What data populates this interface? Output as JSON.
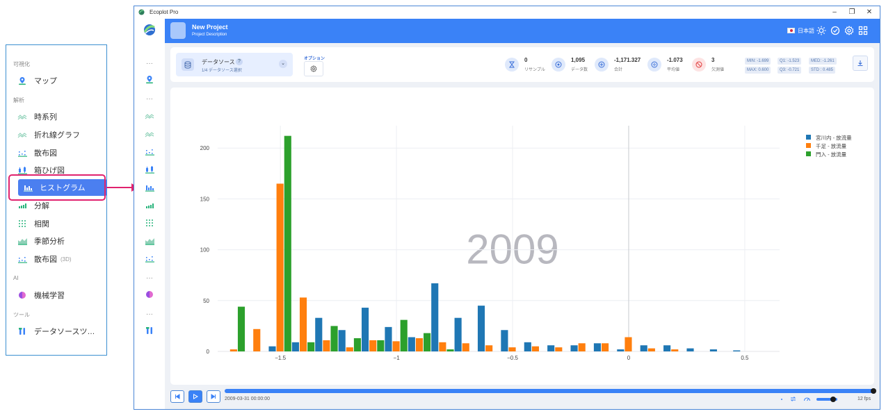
{
  "window": {
    "app_title": "Ecoplot Pro"
  },
  "menu": {
    "sections": {
      "visualization": "可視化",
      "analysis": "解析",
      "ai": "AI",
      "tools": "ツール"
    },
    "items": {
      "map": "マップ",
      "timeseries": "時系列",
      "line": "折れ線グラフ",
      "scatter": "散布図",
      "boxplot": "箱ひげ図",
      "histogram": "ヒストグラム",
      "decomposition": "分解",
      "correlation": "相関",
      "seasonal": "季節分析",
      "scatter3d": "散布図",
      "scatter3d_tag": "(3D)",
      "ml": "機械学習",
      "datasource_tools": "データソースツ…"
    },
    "active_item": "histogram"
  },
  "header": {
    "project_name": "New Project",
    "project_description": "Project Description",
    "language": "日本語"
  },
  "toolbar": {
    "datasource_title": "データソース",
    "datasource_help": "?",
    "datasource_subtitle": "1/4 データソース選択",
    "options_label": "オプション",
    "stats": {
      "resample_value": "0",
      "resample_label": "リサンプル",
      "count_value": "1,095",
      "count_label": "データ数",
      "sum_value": "-1,171.327",
      "sum_label": "合計",
      "mean_value": "-1.073",
      "mean_label": "平均値",
      "missing_value": "3",
      "missing_label": "欠測値"
    },
    "quantiles": {
      "min": "MIN: -1.699",
      "q1": "Q1:   -1.523",
      "med": "MED: -1.261",
      "max": "MAX: 0.600",
      "q3": "Q3:   -0.721",
      "std": "STD : 0.485"
    }
  },
  "player": {
    "timestamp": "2009-03-31 00:00:00",
    "fps": "12 fps",
    "progress": 1.0
  },
  "chart_data": {
    "type": "bar",
    "watermark": "2009",
    "x_bin_centers": [
      -1.7,
      -1.6,
      -1.5,
      -1.4,
      -1.3,
      -1.2,
      -1.1,
      -1.0,
      -0.9,
      -0.8,
      -0.7,
      -0.6,
      -0.5,
      -0.4,
      -0.3,
      -0.2,
      -0.1,
      0.0,
      0.1,
      0.2,
      0.3,
      0.4,
      0.5,
      0.6
    ],
    "series": [
      {
        "name": "宮川内 - 放流量",
        "color": "#1f77b4",
        "values": [
          0,
          0,
          5,
          9,
          33,
          21,
          43,
          24,
          14,
          67,
          33,
          45,
          21,
          9,
          6,
          6,
          8,
          2,
          6,
          6,
          3,
          2,
          1,
          0
        ]
      },
      {
        "name": "千足 - 放流量",
        "color": "#ff7f0e",
        "values": [
          2,
          22,
          165,
          53,
          11,
          4,
          11,
          10,
          13,
          9,
          8,
          6,
          4,
          5,
          4,
          8,
          8,
          14,
          3,
          2,
          0,
          0,
          0,
          0
        ]
      },
      {
        "name": "門入 - 放流量",
        "color": "#2ca02c",
        "values": [
          44,
          0,
          212,
          9,
          25,
          13,
          11,
          31,
          18,
          2,
          0,
          0,
          0,
          0,
          0,
          0,
          0,
          0,
          0,
          0,
          0,
          0,
          0,
          0
        ]
      }
    ],
    "x_ticks": [
      -1.5,
      -1,
      -0.5,
      0,
      0.5
    ],
    "x_tick_labels": [
      "−1.5",
      "−1",
      "−0.5",
      "0",
      "0.5"
    ],
    "y_ticks": [
      0,
      50,
      100,
      150,
      200
    ],
    "y_tick_labels": [
      "0",
      "50",
      "100",
      "150",
      "200"
    ],
    "xlim": [
      -1.77,
      0.65
    ],
    "ylim": [
      0,
      222
    ],
    "grid": true,
    "legend_position": "top-right"
  }
}
